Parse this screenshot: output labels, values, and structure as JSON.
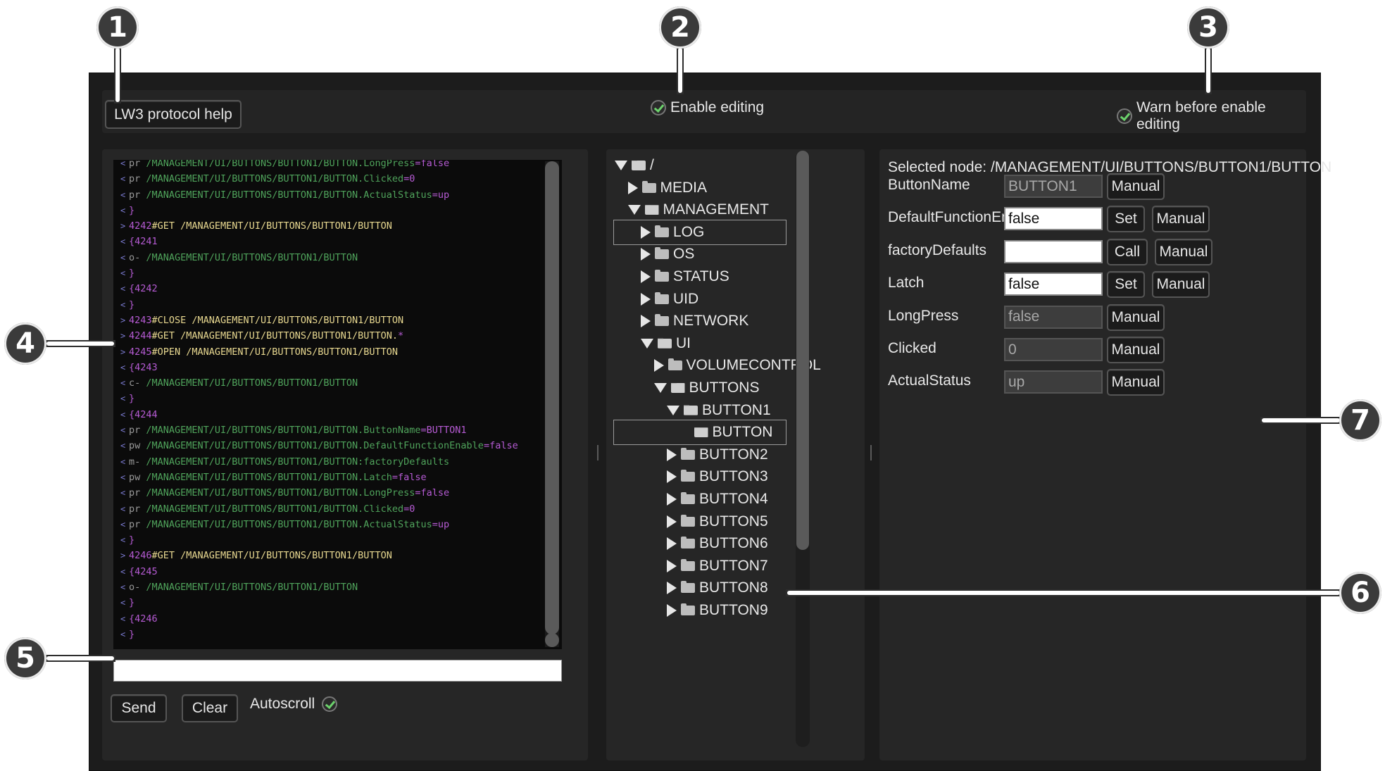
{
  "callouts": [
    "1",
    "2",
    "3",
    "4",
    "5",
    "6",
    "7"
  ],
  "toolbar": {
    "help_label": "LW3 protocol help",
    "enable_editing_label": "Enable editing",
    "warn_label": "Warn before enable editing"
  },
  "console": {
    "lines": [
      {
        "p": "<",
        "t": [
          [
            "pr ",
            "op"
          ],
          [
            "/MANAGEMENT/UI/BUTTONS/BUTTON1/BUTTON.LongPress",
            "path"
          ],
          [
            "=false",
            "val"
          ]
        ]
      },
      {
        "p": "<",
        "t": [
          [
            "pr ",
            "op"
          ],
          [
            "/MANAGEMENT/UI/BUTTONS/BUTTON1/BUTTON.Clicked",
            "path"
          ],
          [
            "=0",
            "val"
          ]
        ]
      },
      {
        "p": "<",
        "t": [
          [
            "pr ",
            "op"
          ],
          [
            "/MANAGEMENT/UI/BUTTONS/BUTTON1/BUTTON.ActualStatus",
            "path"
          ],
          [
            "=up",
            "val"
          ]
        ]
      },
      {
        "p": "<",
        "t": [
          [
            "}",
            "brace"
          ]
        ]
      },
      {
        "p": ">",
        "t": [
          [
            "4242",
            "val"
          ],
          [
            "#GET /MANAGEMENT/UI/BUTTONS/BUTTON1/BUTTON",
            "cmd"
          ]
        ]
      },
      {
        "p": "<",
        "t": [
          [
            "{4241",
            "brace"
          ]
        ]
      },
      {
        "p": "<",
        "t": [
          [
            "o- ",
            "op"
          ],
          [
            "/MANAGEMENT/UI/BUTTONS/BUTTON1/BUTTON",
            "path"
          ]
        ]
      },
      {
        "p": "<",
        "t": [
          [
            "}",
            "brace"
          ]
        ]
      },
      {
        "p": "<",
        "t": [
          [
            "{4242",
            "brace"
          ]
        ]
      },
      {
        "p": "<",
        "t": [
          [
            "}",
            "brace"
          ]
        ]
      },
      {
        "p": ">",
        "t": [
          [
            "4243",
            "val"
          ],
          [
            "#CLOSE /MANAGEMENT/UI/BUTTONS/BUTTON1/BUTTON",
            "cmd"
          ]
        ]
      },
      {
        "p": ">",
        "t": [
          [
            "4244",
            "val"
          ],
          [
            "#GET /MANAGEMENT/UI/BUTTONS/BUTTON1/BUTTON.",
            "cmd"
          ],
          [
            "*",
            "val"
          ]
        ]
      },
      {
        "p": ">",
        "t": [
          [
            "4245",
            "val"
          ],
          [
            "#OPEN /MANAGEMENT/UI/BUTTONS/BUTTON1/BUTTON",
            "cmd"
          ]
        ]
      },
      {
        "p": "<",
        "t": [
          [
            "{4243",
            "brace"
          ]
        ]
      },
      {
        "p": "<",
        "t": [
          [
            "c- ",
            "op"
          ],
          [
            "/MANAGEMENT/UI/BUTTONS/BUTTON1/BUTTON",
            "path"
          ]
        ]
      },
      {
        "p": "<",
        "t": [
          [
            "}",
            "brace"
          ]
        ]
      },
      {
        "p": "<",
        "t": [
          [
            "{4244",
            "brace"
          ]
        ]
      },
      {
        "p": "<",
        "t": [
          [
            "pr ",
            "op"
          ],
          [
            "/MANAGEMENT/UI/BUTTONS/BUTTON1/BUTTON.ButtonName",
            "path"
          ],
          [
            "=BUTTON1",
            "val"
          ]
        ]
      },
      {
        "p": "<",
        "t": [
          [
            "pw ",
            "op"
          ],
          [
            "/MANAGEMENT/UI/BUTTONS/BUTTON1/BUTTON.DefaultFunctionEnable",
            "path"
          ],
          [
            "=false",
            "val"
          ]
        ]
      },
      {
        "p": "<",
        "t": [
          [
            "m- ",
            "op"
          ],
          [
            "/MANAGEMENT/UI/BUTTONS/BUTTON1/BUTTON:factoryDefaults",
            "path"
          ]
        ]
      },
      {
        "p": "<",
        "t": [
          [
            "pw ",
            "op"
          ],
          [
            "/MANAGEMENT/UI/BUTTONS/BUTTON1/BUTTON.Latch",
            "path"
          ],
          [
            "=false",
            "val"
          ]
        ]
      },
      {
        "p": "<",
        "t": [
          [
            "pr ",
            "op"
          ],
          [
            "/MANAGEMENT/UI/BUTTONS/BUTTON1/BUTTON.LongPress",
            "path"
          ],
          [
            "=false",
            "val"
          ]
        ]
      },
      {
        "p": "<",
        "t": [
          [
            "pr ",
            "op"
          ],
          [
            "/MANAGEMENT/UI/BUTTONS/BUTTON1/BUTTON.Clicked",
            "path"
          ],
          [
            "=0",
            "val"
          ]
        ]
      },
      {
        "p": "<",
        "t": [
          [
            "pr ",
            "op"
          ],
          [
            "/MANAGEMENT/UI/BUTTONS/BUTTON1/BUTTON.ActualStatus",
            "path"
          ],
          [
            "=up",
            "val"
          ]
        ]
      },
      {
        "p": "<",
        "t": [
          [
            "}",
            "brace"
          ]
        ]
      },
      {
        "p": ">",
        "t": [
          [
            "4246",
            "val"
          ],
          [
            "#GET /MANAGEMENT/UI/BUTTONS/BUTTON1/BUTTON",
            "cmd"
          ]
        ]
      },
      {
        "p": "<",
        "t": [
          [
            "{4245",
            "brace"
          ]
        ]
      },
      {
        "p": "<",
        "t": [
          [
            "o- ",
            "op"
          ],
          [
            "/MANAGEMENT/UI/BUTTONS/BUTTON1/BUTTON",
            "path"
          ]
        ]
      },
      {
        "p": "<",
        "t": [
          [
            "}",
            "brace"
          ]
        ]
      },
      {
        "p": "<",
        "t": [
          [
            "{4246",
            "brace"
          ]
        ]
      },
      {
        "p": "<",
        "t": [
          [
            "}",
            "brace"
          ]
        ]
      }
    ],
    "input_value": "",
    "send_label": "Send",
    "clear_label": "Clear",
    "autoscroll_label": "Autoscroll"
  },
  "tree": {
    "nodes": [
      {
        "label": "/",
        "level": 0,
        "state": "open"
      },
      {
        "label": "MEDIA",
        "level": 1,
        "state": "closed"
      },
      {
        "label": "MANAGEMENT",
        "level": 1,
        "state": "open"
      },
      {
        "label": "LOG",
        "level": 2,
        "state": "closed",
        "boxed": true
      },
      {
        "label": "OS",
        "level": 2,
        "state": "closed"
      },
      {
        "label": "STATUS",
        "level": 2,
        "state": "closed"
      },
      {
        "label": "UID",
        "level": 2,
        "state": "closed"
      },
      {
        "label": "NETWORK",
        "level": 2,
        "state": "closed"
      },
      {
        "label": "UI",
        "level": 2,
        "state": "open"
      },
      {
        "label": "VOLUMECONTROL",
        "level": 3,
        "state": "closed"
      },
      {
        "label": "BUTTONS",
        "level": 3,
        "state": "open"
      },
      {
        "label": "BUTTON1",
        "level": 4,
        "state": "open"
      },
      {
        "label": "BUTTON",
        "level": 5,
        "state": "leaf",
        "boxed": true
      },
      {
        "label": "BUTTON2",
        "level": 4,
        "state": "closed"
      },
      {
        "label": "BUTTON3",
        "level": 4,
        "state": "closed"
      },
      {
        "label": "BUTTON4",
        "level": 4,
        "state": "closed"
      },
      {
        "label": "BUTTON5",
        "level": 4,
        "state": "closed"
      },
      {
        "label": "BUTTON6",
        "level": 4,
        "state": "closed"
      },
      {
        "label": "BUTTON7",
        "level": 4,
        "state": "closed"
      },
      {
        "label": "BUTTON8",
        "level": 4,
        "state": "closed"
      },
      {
        "label": "BUTTON9",
        "level": 4,
        "state": "closed"
      }
    ]
  },
  "properties": {
    "selected_node_label": "Selected node: /MANAGEMENT/UI/BUTTONS/BUTTON1/BUTTON",
    "rows": [
      {
        "name": "ButtonName",
        "value": "BUTTON1",
        "editable": false,
        "action": "",
        "manual": "Manual"
      },
      {
        "name": "DefaultFunctionEna...",
        "value": "false",
        "editable": true,
        "action": "Set",
        "manual": "Manual"
      },
      {
        "name": "factoryDefaults",
        "value": "",
        "editable": true,
        "action": "Call",
        "manual": "Manual"
      },
      {
        "name": "Latch",
        "value": "false",
        "editable": true,
        "action": "Set",
        "manual": "Manual"
      },
      {
        "name": "LongPress",
        "value": "false",
        "editable": false,
        "action": "",
        "manual": "Manual"
      },
      {
        "name": "Clicked",
        "value": "0",
        "editable": false,
        "action": "",
        "manual": "Manual"
      },
      {
        "name": "ActualStatus",
        "value": "up",
        "editable": false,
        "action": "",
        "manual": "Manual"
      }
    ]
  },
  "colors": {
    "frame": "#1c1c1c",
    "panel": "#262626",
    "console_bg": "#0b0b0b",
    "check_green": "#6cd26c"
  }
}
